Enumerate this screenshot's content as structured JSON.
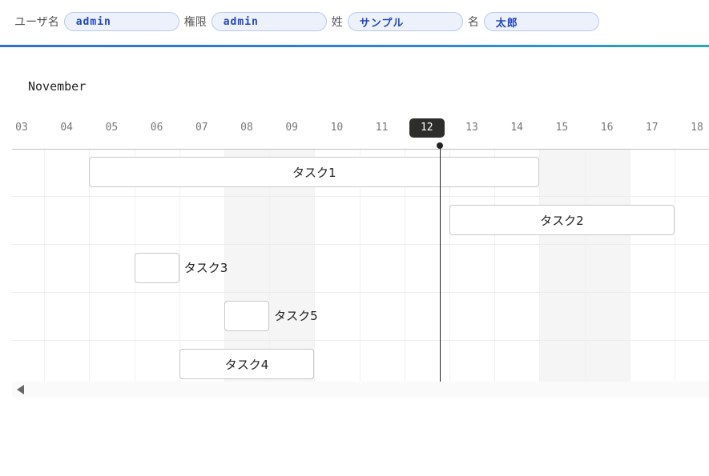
{
  "header": {
    "fields": [
      {
        "label": "ユーザ名",
        "value": "admin"
      },
      {
        "label": "権限",
        "value": "admin"
      },
      {
        "label": "姓",
        "value": "サンプル"
      },
      {
        "label": "名",
        "value": "太郎"
      }
    ]
  },
  "timeline": {
    "month": "November",
    "days": [
      "03",
      "04",
      "05",
      "06",
      "07",
      "08",
      "09",
      "10",
      "11",
      "12",
      "13",
      "14",
      "15",
      "16",
      "17",
      "18"
    ],
    "today": "12",
    "weekend_days": [
      "08",
      "09",
      "15",
      "16"
    ],
    "tasks": [
      {
        "name": "タスク1",
        "start": "04.5",
        "end": "14.5",
        "row": 0
      },
      {
        "name": "タスク2",
        "start": "12.5",
        "end": "17.5",
        "row": 1
      },
      {
        "name": "タスク3",
        "start": "05.5",
        "end": "06.5",
        "row": 2
      },
      {
        "name": "タスク5",
        "start": "07.5",
        "end": "08.5",
        "row": 3
      },
      {
        "name": "タスク4",
        "start": "06.5",
        "end": "09.5",
        "row": 4
      }
    ]
  },
  "colors": {
    "accent": "#2f6fd6",
    "pill_bg": "#edf1fb",
    "pill_text": "#2147c2",
    "today_bg": "#2d2d2b"
  }
}
